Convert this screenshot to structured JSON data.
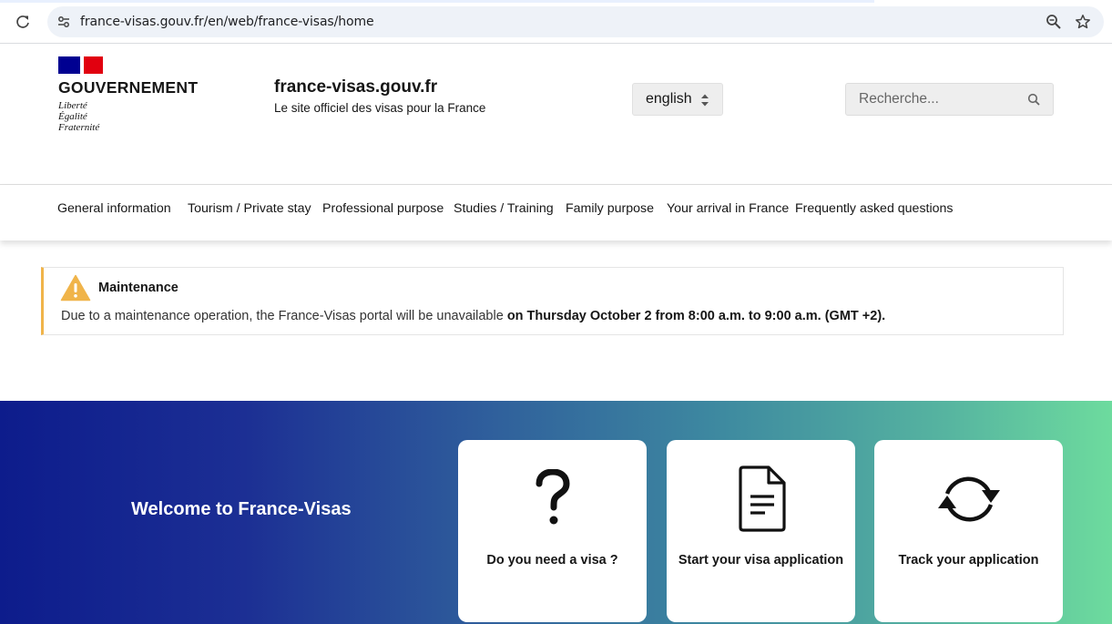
{
  "browser": {
    "url": "france-visas.gouv.fr/en/web/france-visas/home"
  },
  "header": {
    "gov_title": "GOUVERNEMENT",
    "devise": [
      "Liberté",
      "Égalité",
      "Fraternité"
    ],
    "site_name": "france-visas.gouv.fr",
    "tagline": "Le site officiel des visas pour la France",
    "language": "english",
    "search_placeholder": "Recherche..."
  },
  "nav": {
    "items": [
      "General information",
      "Tourism / Private stay",
      "Professional purpose",
      "Studies / Training",
      "Family purpose",
      "Your arrival in France",
      "Frequently asked questions"
    ]
  },
  "notice": {
    "title": "Maintenance",
    "text": "Due to a maintenance operation, the France-Visas portal will be unavailable ",
    "text_bold": "on Thursday October 2 from 8:00 a.m. to 9:00 a.m. (GMT +2)."
  },
  "hero": {
    "title": "Welcome to France-Visas",
    "cards": [
      {
        "label": "Do you need a visa ?",
        "icon": "question-mark-icon"
      },
      {
        "label": "Start your visa application",
        "icon": "document-icon"
      },
      {
        "label": "Track your application",
        "icon": "refresh-icon"
      }
    ]
  },
  "colors": {
    "brand_blue": "#000091",
    "brand_red": "#e1000f",
    "warning": "#f0b44a",
    "hero_start": "#0d1c8c",
    "hero_end": "#6ddb9e"
  }
}
